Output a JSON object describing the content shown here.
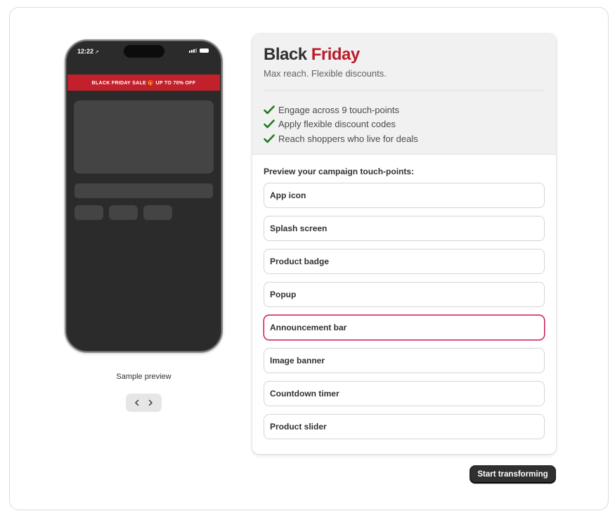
{
  "phone": {
    "time": "12:22",
    "announcement_text": "BLACK FRIDAY SALE 🎁 UP TO 70% OFF"
  },
  "preview": {
    "caption": "Sample preview",
    "prev_icon": "chevron-left-icon",
    "next_icon": "chevron-right-icon"
  },
  "panel": {
    "title_part1": "Black",
    "title_part2": "Friday",
    "subtitle": "Max reach. Flexible discounts.",
    "benefits": [
      "Engage across 9 touch-points",
      "Apply flexible discount codes",
      "Reach shoppers who live for deals"
    ],
    "section_label": "Preview your campaign touch-points:",
    "touchpoints": [
      "App icon",
      "Splash screen",
      "Product badge",
      "Popup",
      "Announcement bar",
      "Image banner",
      "Countdown timer",
      "Product slider"
    ],
    "active_touchpoint": "Announcement bar"
  },
  "cta_label": "Start transforming",
  "colors": {
    "accent_red": "#b91c2a",
    "banner_red": "#c2202b",
    "check_green": "#1f7a1f",
    "active_border": "#d4145a",
    "phone_bg": "#2b2b2b"
  }
}
